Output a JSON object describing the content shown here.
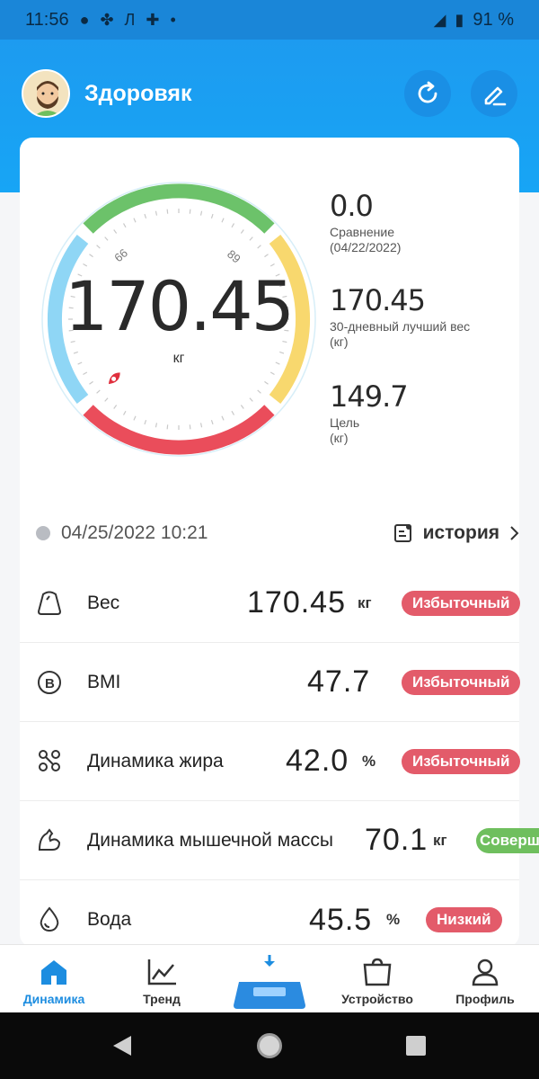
{
  "status_bar": {
    "time": "11:56",
    "battery": "91 %"
  },
  "header": {
    "user_name": "Здоровяк"
  },
  "gauge": {
    "value": "170.45",
    "unit": "кг",
    "tick_left": "66",
    "tick_right": "89",
    "colors": {
      "green": "#6cc26a",
      "yellow": "#f8d86e",
      "red": "#ea4d5b",
      "blue": "#8fd6f5"
    }
  },
  "stats": {
    "comparison": {
      "value": "0.0",
      "label": "Сравнение",
      "sub": "(04/22/2022)"
    },
    "best": {
      "value": "170.45",
      "label": "30-дневный лучший вес",
      "sub": "(кг)"
    },
    "goal": {
      "value": "149.7",
      "label": "Цель",
      "sub": "(кг)"
    }
  },
  "meta": {
    "datetime": "04/25/2022 10:21",
    "history_label": "история"
  },
  "metrics": [
    {
      "label": "Вес",
      "value": "170.45",
      "unit": "кг",
      "badge": "Избыточный",
      "icon": "weight-icon"
    },
    {
      "label": "BMI",
      "value": "47.7",
      "unit": "",
      "badge": "Избыточный",
      "icon": "bmi-icon"
    },
    {
      "label": "Динамика жира",
      "value": "42.0",
      "unit": "%",
      "badge": "Избыточный",
      "icon": "fat-icon"
    },
    {
      "label": "Динамика мышечной массы",
      "value": "70.1",
      "unit": "кг",
      "badge": "Соверш",
      "icon": "muscle-icon"
    },
    {
      "label": "Вода",
      "value": "45.5",
      "unit": "%",
      "badge": "Низкий",
      "icon": "water-drop-icon"
    }
  ],
  "tabs": [
    {
      "label": "Динамика",
      "icon": "home-icon",
      "active": true
    },
    {
      "label": "Тренд",
      "icon": "trend-chart-icon",
      "active": false
    },
    {
      "label": "Устройство",
      "icon": "device-bag-icon",
      "active": false
    },
    {
      "label": "Профиль",
      "icon": "profile-icon",
      "active": false
    }
  ],
  "colors": {
    "header_blue": "#1d9bf0",
    "badge_red": "#e35b6a",
    "badge_green": "#6fbf5e",
    "active_tab": "#1d8de0"
  }
}
